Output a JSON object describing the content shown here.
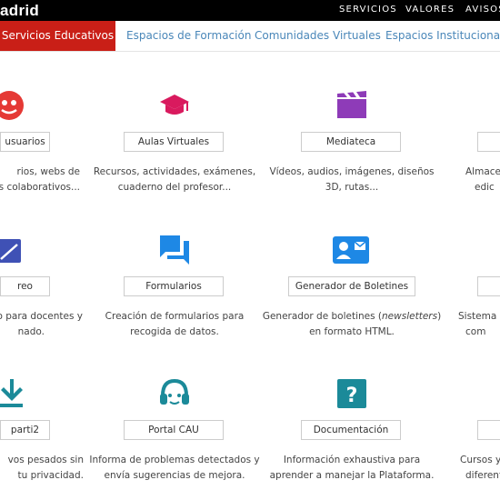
{
  "header": {
    "brand": "adrid",
    "nav": [
      "SERVICIOS",
      "VALORES",
      "AVISOS"
    ]
  },
  "tabs": [
    {
      "label": "Servicios Educativos",
      "active": true
    },
    {
      "label": "Espacios de Formación",
      "active": false
    },
    {
      "label": "Comunidades Virtuales",
      "active": false
    },
    {
      "label": "Espacios Institucionales",
      "active": false
    }
  ],
  "colors": {
    "topbar": "#000000",
    "active_tab": "#c91f17",
    "tab_link": "#4a87b9",
    "aulas_icon": "#d91a5e",
    "mediateca_icon": "#8e3bb8",
    "blue_icon": "#1e88e5",
    "teal_icon": "#1b8a99",
    "correo_icon": "#3f51b5",
    "usuarios_icon": "#e53935"
  },
  "services": [
    {
      "icon": "users-icon",
      "label": "usuarios",
      "desc1": "rios, webs de",
      "desc2": "s colaborativos..."
    },
    {
      "icon": "graduation-cap-icon",
      "label": "Aulas Virtuales",
      "desc1": "Recursos, actividades, exámenes,",
      "desc2": "cuaderno del profesor..."
    },
    {
      "icon": "film-clapper-icon",
      "label": "Mediateca",
      "desc1": "Vídeos, audios, imágenes, diseños",
      "desc2": "3D, rutas..."
    },
    {
      "icon": "storage-icon",
      "label": "",
      "desc1": "Almacen",
      "desc2": "edic"
    },
    {
      "icon": "mail-icon",
      "label": "reo",
      "desc1": "o para docentes y",
      "desc2": "nado."
    },
    {
      "icon": "forum-icon",
      "label": "Formularios",
      "desc1": "Creación de formularios para",
      "desc2": "recogida de datos."
    },
    {
      "icon": "contact-mail-icon",
      "label": "Generador de Boletines",
      "desc1_pre": "Generador de boletines (",
      "desc1_em": "newsletters",
      "desc1_post": ")",
      "desc2": "en formato HTML."
    },
    {
      "icon": "system-icon",
      "label": "",
      "desc1": "Sistema o",
      "desc2": "com"
    },
    {
      "icon": "download-icon",
      "label": "parti2",
      "desc1": "vos pesados sin",
      "desc2": "tu privacidad."
    },
    {
      "icon": "headset-icon",
      "label": "Portal CAU",
      "desc1": "Informa de problemas detectados y",
      "desc2": "envía sugerencias de mejora."
    },
    {
      "icon": "help-icon",
      "label": "Documentación",
      "desc1": "Información exhaustiva para",
      "desc2": "aprender a manejar la Plataforma."
    },
    {
      "icon": "courses-icon",
      "label": "",
      "desc1": "Cursos y p",
      "desc2": "diferente"
    }
  ]
}
